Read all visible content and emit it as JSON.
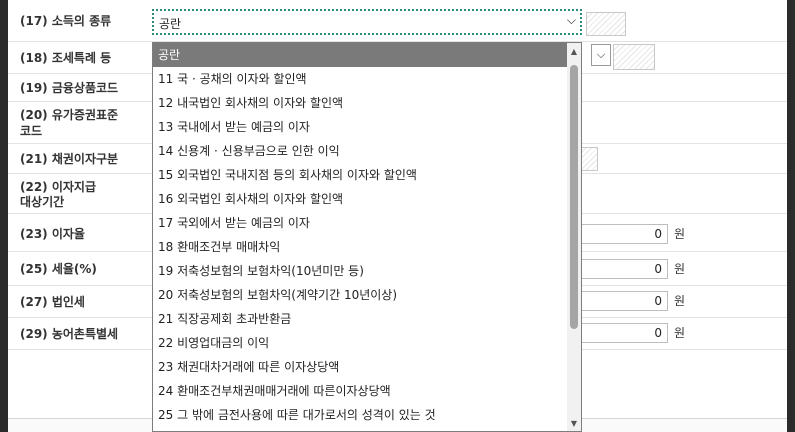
{
  "form": {
    "rows": [
      {
        "label": "(17) 소득의 종류"
      },
      {
        "label": "(18) 조세특례 등"
      },
      {
        "label": "(19) 금융상품코드"
      },
      {
        "label_line1": "(20) 유가증권표준",
        "label_line2": "코드"
      },
      {
        "label": "(21) 채권이자구분"
      },
      {
        "label_line1": "(22) 이자지급",
        "label_line2": "대상기간"
      },
      {
        "label": "(23) 이자율",
        "value": "0",
        "unit": "원"
      },
      {
        "label": "(25) 세율(%)",
        "value": "0",
        "unit": "원"
      },
      {
        "label": "(27) 법인세",
        "value": "0",
        "unit": "원"
      },
      {
        "label": "(29) 농어촌특별세",
        "value": "0",
        "unit": "원"
      }
    ],
    "income_type_select": {
      "value": "공란"
    }
  },
  "dropdown": {
    "options": [
      "공란",
      "11 국 · 공채의 이자와 할인액",
      "12 내국법인 회사채의 이자와 할인액",
      "13 국내에서 받는 예금의 이자",
      "14 신용계 · 신용부금으로 인한 이익",
      "15 외국법인 국내지점 등의 회사채의 이자와 할인액",
      "16 외국법인 회사채의 이자와 할인액",
      "17 국외에서 받는 예금의 이자",
      "18 환매조건부 매매차익",
      "19 저축성보험의 보험차익(10년미만 등)",
      "20 저축성보험의 보험차익(계약기간 10년이상)",
      "21 직장공제회 초과반환금",
      "22 비영업대금의 이익",
      "23 채권대차거래에 따른 이자상당액",
      "24 환매조건부채권매매거래에 따른이자상당액",
      "25 그 밖에 금전사용에 따른 대가로서의 성격이 있는 것"
    ],
    "selected": "공란"
  },
  "icons": {
    "select_arrow": "chevron-down-icon",
    "scroll_up": "scroll-up-icon",
    "scroll_down": "scroll-down-icon"
  }
}
